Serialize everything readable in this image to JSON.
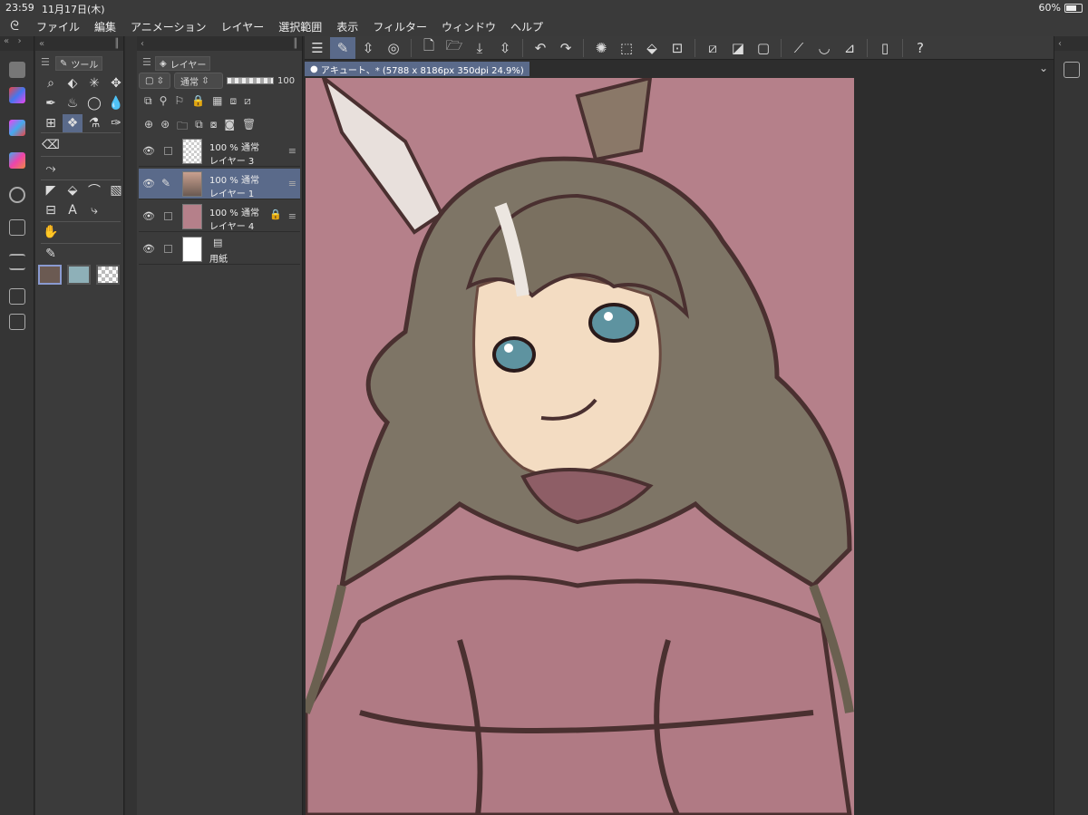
{
  "status": {
    "time": "23:59",
    "date": "11月17日(木)",
    "battery": "60%"
  },
  "menubar": {
    "items": [
      "ファイル",
      "編集",
      "アニメーション",
      "レイヤー",
      "選択範囲",
      "表示",
      "フィルター",
      "ウィンドウ",
      "ヘルプ"
    ]
  },
  "tool_panel": {
    "tab_label": "ツール"
  },
  "layer_panel": {
    "tab_label": "レイヤー",
    "blend_mode": "通常",
    "opacity": "100",
    "layers": [
      {
        "opacity_mode": "100 % 通常",
        "name": "レイヤー 3"
      },
      {
        "opacity_mode": "100 % 通常",
        "name": "レイヤー 1"
      },
      {
        "opacity_mode": "100 % 通常",
        "name": "レイヤー 4"
      },
      {
        "name": "用紙"
      }
    ]
  },
  "document": {
    "tab_label": "アキュート、* (5788 x 8186px 350dpi 24.9%)"
  },
  "colors": {
    "main_color": "#6b5a52",
    "sub_color": "#8eb0b8",
    "canvas_bg": "#b5808a",
    "accent": "#5a6a8a"
  }
}
